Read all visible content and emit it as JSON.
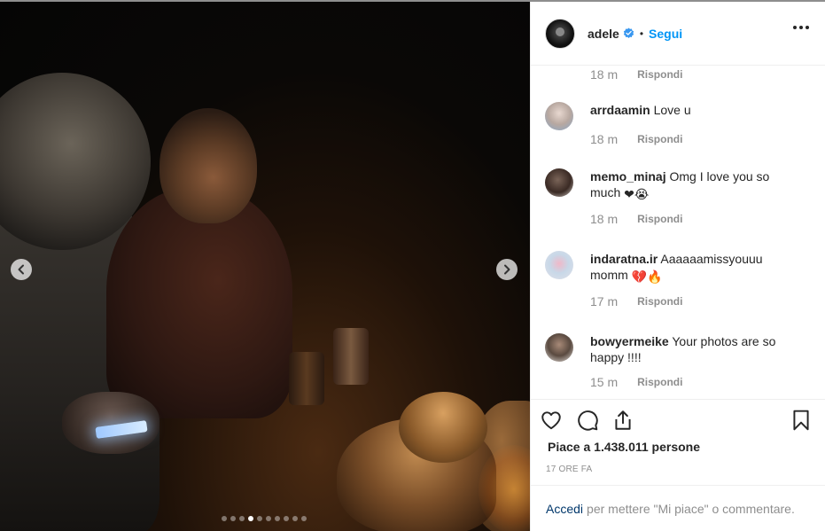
{
  "post": {
    "author": "adele",
    "separator": "•",
    "follow_label": "Segui",
    "image_alt": "Campfire photo"
  },
  "carousel": {
    "total": 10,
    "active_index": 3
  },
  "first_meta": {
    "time": "18 m",
    "reply_label": "Rispondi"
  },
  "comments": [
    {
      "user": "arrdaamin",
      "text": "Love u",
      "emoji": "",
      "time": "18 m",
      "reply_label": "Rispondi"
    },
    {
      "user": "memo_minaj",
      "text": "Omg I love you so much",
      "emoji": "❤😭",
      "time": "18 m",
      "reply_label": "Rispondi"
    },
    {
      "user": "indaratna.ir",
      "text": "Aaaaaamissyouuu momm",
      "emoji": "💔🔥",
      "time": "17 m",
      "reply_label": "Rispondi"
    },
    {
      "user": "bowyermeike",
      "text": "Your photos are so happy !!!!",
      "emoji": "",
      "time": "15 m",
      "reply_label": "Rispondi"
    }
  ],
  "likes_text": "Piace a 1.438.011 persone",
  "posted_ago": "17 ORE FA",
  "footer": {
    "login_label": "Accedi",
    "rest_text": "per mettere \"Mi piace\" o commentare."
  },
  "colors": {
    "link_blue": "#0095f6",
    "text_dark": "#262626",
    "text_muted": "#8e8e8e",
    "login_blue": "#00376b"
  },
  "icons": [
    "chevron-left-icon",
    "chevron-right-icon",
    "verified-badge-icon",
    "more-options-icon",
    "heart-icon",
    "comment-icon",
    "share-icon",
    "bookmark-icon"
  ]
}
